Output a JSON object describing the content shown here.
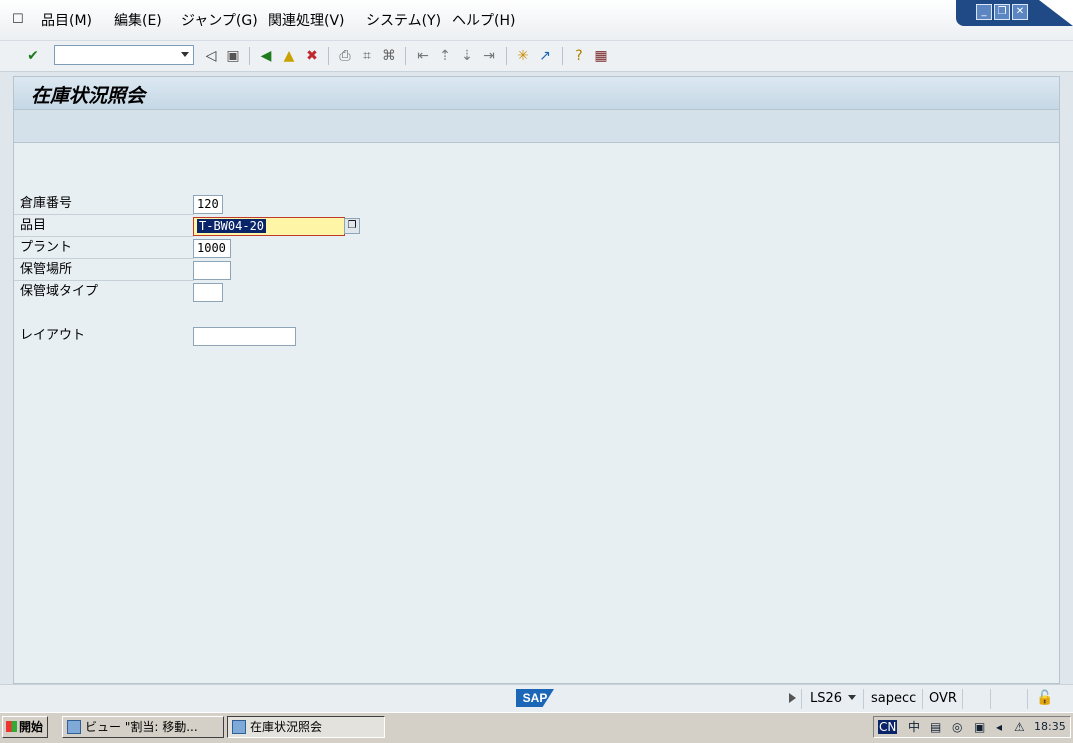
{
  "menu": {
    "items": [
      "品目(M)",
      "編集(E)",
      "ジャンプ(G)",
      "関連処理(V)",
      "システム(Y)",
      "ヘルプ(H)"
    ]
  },
  "toolbar": {
    "command_value": "",
    "icons": [
      "enter-icon",
      "back-nav-icon",
      "save-icon",
      "back-icon",
      "exit-icon",
      "cancel-icon",
      "print-icon",
      "find-icon",
      "find-next-icon",
      "first-page-icon",
      "prev-page-icon",
      "next-page-icon",
      "last-page-icon",
      "create-session-icon",
      "shortcut-icon",
      "help-icon",
      "layout-icon"
    ]
  },
  "page": {
    "title": "在庫状況照会"
  },
  "form": {
    "warehouse_label": "倉庫番号",
    "warehouse_value": "120",
    "material_label": "品目",
    "material_value": "T-BW04-20",
    "plant_label": "プラント",
    "plant_value": "1000",
    "storage_location_label": "保管場所",
    "storage_location_value": "",
    "storage_type_label": "保管域タイプ",
    "storage_type_value": "",
    "layout_label": "レイアウト",
    "layout_value": ""
  },
  "status": {
    "logo": "SAP",
    "system": "LS26",
    "server": "sapecc",
    "mode": "OVR"
  },
  "taskbar": {
    "start_label": "開始",
    "tasks": [
      "ビュー \"割当: 移動...",
      "在庫状況照会"
    ],
    "tray_time": "18:35",
    "tray_text": "CN"
  },
  "colors": {
    "title_bar": "#c5d8e6",
    "content_bg": "#e8eff3",
    "focus_field": "#fff5a6",
    "selection": "#0a246a",
    "sap_blue": "#1b66b6"
  }
}
